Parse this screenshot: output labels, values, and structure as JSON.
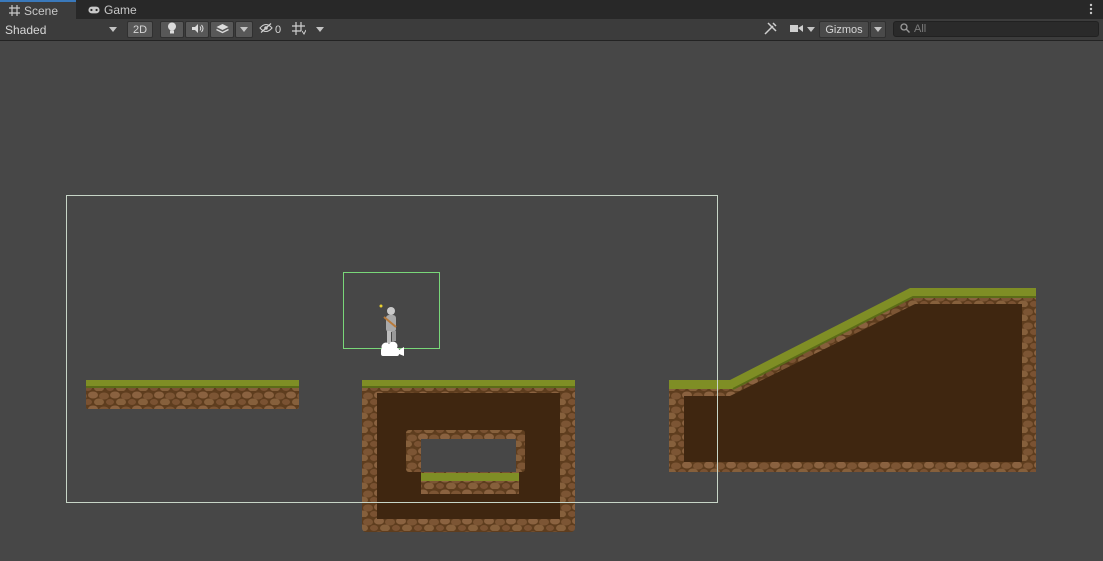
{
  "tabs": [
    {
      "label": "Scene",
      "icon": "grid-icon",
      "active": true
    },
    {
      "label": "Game",
      "icon": "gamepad-icon",
      "active": false
    }
  ],
  "toolbar": {
    "draw_mode": "Shaded",
    "toggle_2d": "2D",
    "hidden_count": "0",
    "gizmos": "Gizmos",
    "search_placeholder": "All"
  },
  "colors": {
    "panel_bg": "#474747",
    "toolbar_bg": "#3c3c3c",
    "camera_frame": "#c8d8c8",
    "selection_frame": "#7dd87d",
    "grass": "#8a9a2c",
    "dirt": "#4a2c12"
  },
  "scene": {
    "objects": [
      "main-camera-frame",
      "player-character",
      "grass-platform-left",
      "ground-pit-block",
      "grass-slope-hill"
    ]
  }
}
